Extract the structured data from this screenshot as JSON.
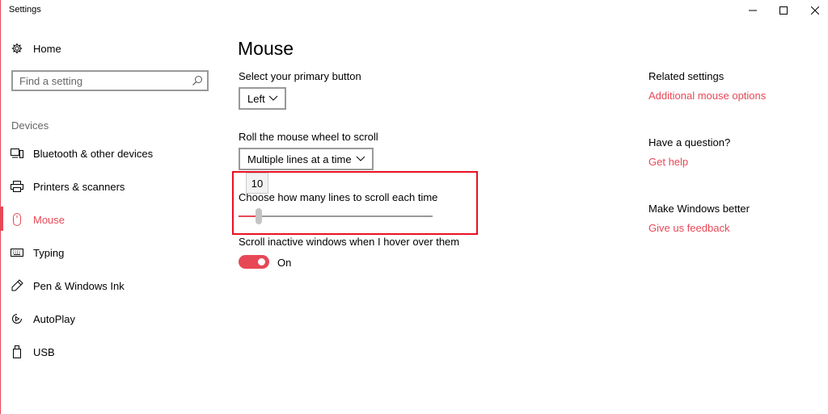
{
  "window": {
    "title": "Settings",
    "controls": {
      "minimize": "—",
      "maximize": "☐",
      "close": "✕"
    }
  },
  "sidebar": {
    "home_label": "Home",
    "search": {
      "placeholder": "Find a setting"
    },
    "group_label": "Devices",
    "items": [
      {
        "label": "Bluetooth & other devices",
        "icon": "bluetooth-devices-icon"
      },
      {
        "label": "Printers & scanners",
        "icon": "printer-icon"
      },
      {
        "label": "Mouse",
        "icon": "mouse-icon",
        "selected": true
      },
      {
        "label": "Typing",
        "icon": "keyboard-icon"
      },
      {
        "label": "Pen & Windows Ink",
        "icon": "pen-icon"
      },
      {
        "label": "AutoPlay",
        "icon": "autoplay-icon"
      },
      {
        "label": "USB",
        "icon": "usb-icon"
      }
    ]
  },
  "main": {
    "title": "Mouse",
    "primary_button": {
      "label": "Select your primary button",
      "value": "Left"
    },
    "scroll_mode": {
      "label": "Roll the mouse wheel to scroll",
      "value": "Multiple lines at a time"
    },
    "lines_slider": {
      "label": "Choose how many lines to scroll each time",
      "value": 10,
      "min": 1,
      "max": 100,
      "tooltip": "10"
    },
    "inactive_scroll": {
      "label": "Scroll inactive windows when I hover over them",
      "state": "On"
    }
  },
  "related": {
    "related_settings": {
      "heading": "Related settings",
      "link": "Additional mouse options"
    },
    "question": {
      "heading": "Have a question?",
      "link": "Get help"
    },
    "better": {
      "heading": "Make Windows better",
      "link": "Give us feedback"
    }
  },
  "colors": {
    "accent": "#e74856",
    "highlight_border": "#e81123",
    "border_gray": "#999999"
  }
}
